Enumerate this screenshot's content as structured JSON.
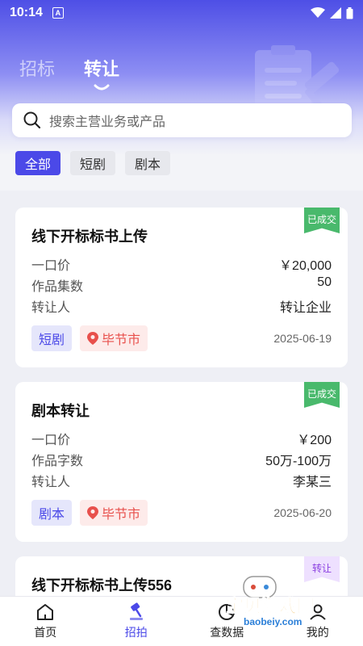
{
  "status": {
    "time": "10:14",
    "notif_letter": "A"
  },
  "tabs": [
    {
      "label": "招标",
      "active": false
    },
    {
      "label": "转让",
      "active": true
    }
  ],
  "search": {
    "placeholder": "搜索主营业务或产品"
  },
  "filters": [
    {
      "label": "全部",
      "active": true
    },
    {
      "label": "短剧",
      "active": false
    },
    {
      "label": "剧本",
      "active": false
    }
  ],
  "cards": [
    {
      "title": "线下开标标书上传",
      "badge": "已成交",
      "rows": [
        {
          "k": "一口价",
          "v": "￥20,000"
        },
        {
          "k": "作品集数",
          "v": "50"
        },
        {
          "k": "转让人",
          "v": "转让企业"
        }
      ],
      "type_tag": "短剧",
      "location": "毕节市",
      "date": "2025-06-19"
    },
    {
      "title": "剧本转让",
      "badge": "已成交",
      "rows": [
        {
          "k": "一口价",
          "v": "￥200"
        },
        {
          "k": "作品字数",
          "v": "50万-100万"
        },
        {
          "k": "转让人",
          "v": "李某三"
        }
      ],
      "type_tag": "剧本",
      "location": "毕节市",
      "date": "2025-06-20"
    },
    {
      "title": "线下开标标书上传556",
      "badge": "转让"
    }
  ],
  "nav": [
    {
      "label": "首页",
      "icon": "home-icon",
      "active": false
    },
    {
      "label": "招拍",
      "icon": "gavel-icon",
      "active": true
    },
    {
      "label": "查数据",
      "icon": "data-icon",
      "active": false
    },
    {
      "label": "我的",
      "icon": "user-icon",
      "active": false
    }
  ],
  "watermark": {
    "title": "宝贝游戏网",
    "url": "baobeiy.com"
  },
  "colors": {
    "primary": "#4b49e8",
    "success": "#49b96c",
    "location": "#e8504c"
  }
}
